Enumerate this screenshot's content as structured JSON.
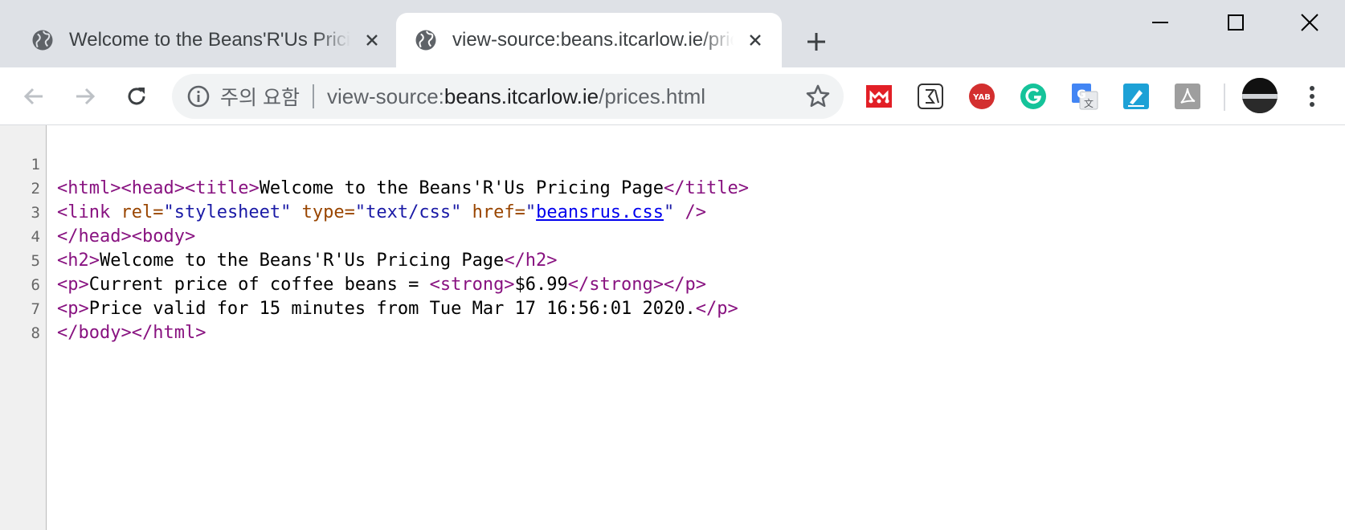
{
  "tabs": [
    {
      "title": "Welcome to the Beans'R'Us Pricing Page",
      "active": false
    },
    {
      "title": "view-source:beans.itcarlow.ie/prices.html",
      "active": true
    }
  ],
  "omnibox": {
    "security_text": "주의 요함",
    "url_prefix": "view-source:",
    "url_host": "beans.itcarlow.ie",
    "url_path": "/prices.html"
  },
  "extensions": [
    "mendeley-icon",
    "sigma-extension-icon",
    "yab-extension-icon",
    "grammarly-icon",
    "google-translate-icon",
    "pen-extension-icon",
    "pdf-extension-icon"
  ],
  "source": {
    "line_numbers": [
      "1",
      "2",
      "3",
      "4",
      "5",
      "6",
      "7",
      "8"
    ],
    "l1": {
      "o_html": "<html>",
      "o_head": "<head>",
      "o_title": "<title>",
      "title_text": "Welcome to the Beans'R'Us Pricing Page",
      "c_title": "</title>"
    },
    "l2": {
      "link_open": "<link",
      "rel_attr": " rel=",
      "rel_val": "\"stylesheet\"",
      "type_attr": " type=",
      "type_val": "\"text/css\"",
      "href_attr": " href=",
      "href_q1": "\"",
      "href_link": "beansrus.css",
      "href_q2": "\"",
      "link_close": " />"
    },
    "l3": {
      "c_head": "</head>",
      "o_body": "<body>"
    },
    "l4": {
      "o_h2": "<h2>",
      "text": "Welcome to the Beans'R'Us Pricing Page",
      "c_h2": "</h2>"
    },
    "l5": {
      "o_p": "<p>",
      "text": "Current price of coffee beans = ",
      "o_strong": "<strong>",
      "price": "$6.99",
      "c_strong": "</strong>",
      "c_p": "</p>"
    },
    "l6": {
      "o_p": "<p>",
      "text": "Price valid for 15 minutes from Tue Mar 17 16:56:01 2020.",
      "c_p": "</p>"
    },
    "l7": {
      "c_body": "</body>",
      "c_html": "</html>"
    },
    "l8": ""
  },
  "colors": {
    "tag": "#881280",
    "attribute": "#994500",
    "value": "#1a1aa6",
    "link": "#0000ee",
    "tabstrip": "#dee1e6"
  }
}
